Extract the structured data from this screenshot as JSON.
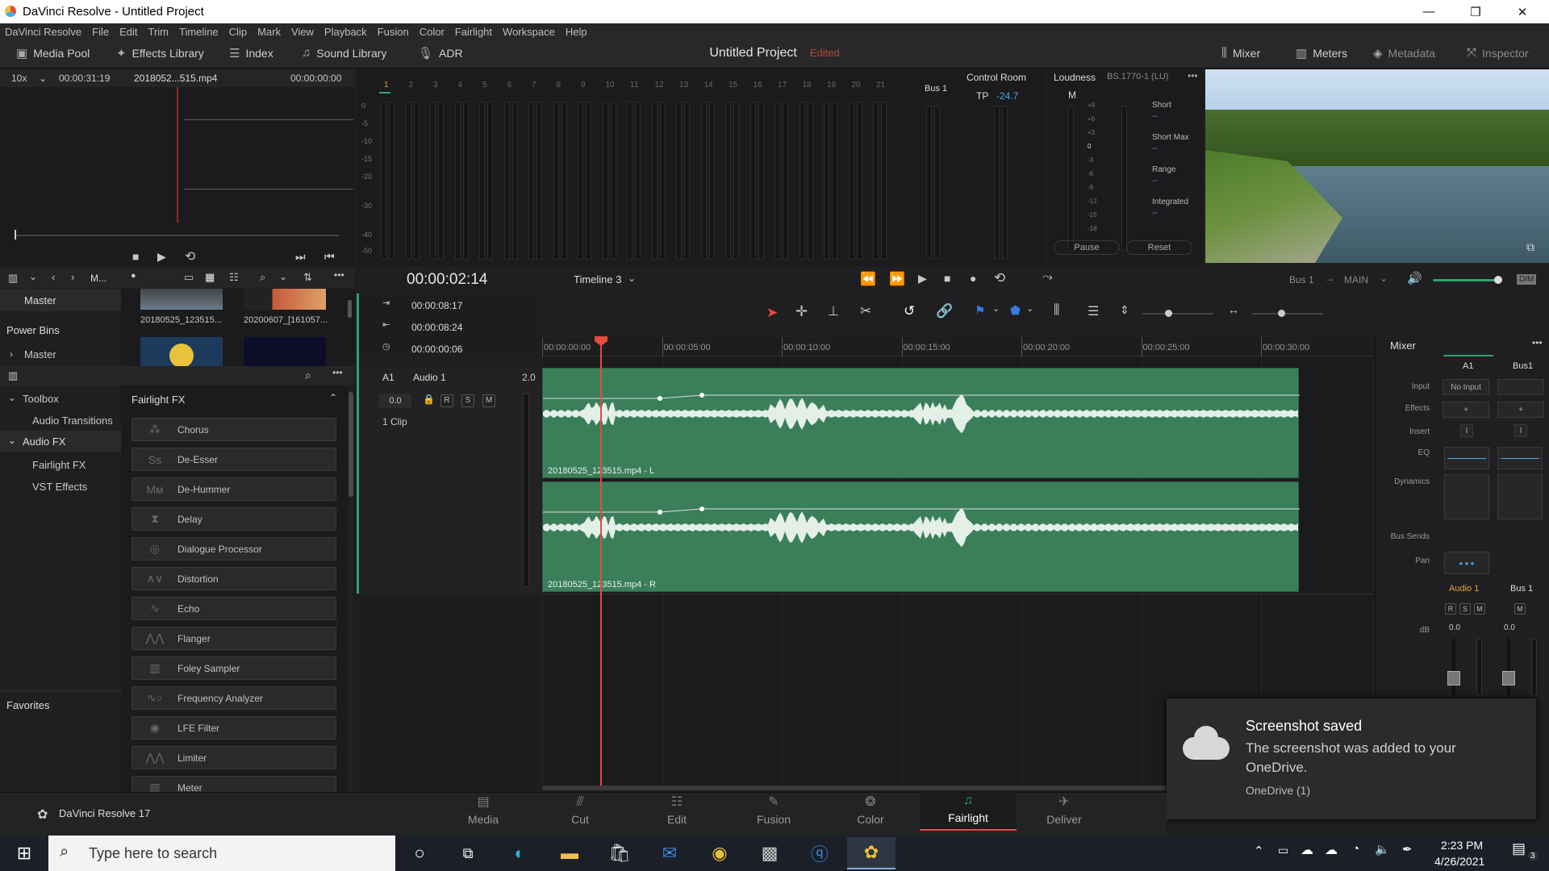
{
  "window": {
    "title": "DaVinci Resolve - Untitled Project",
    "min": "—",
    "max": "❐",
    "close": "✕"
  },
  "menu": [
    "DaVinci Resolve",
    "File",
    "Edit",
    "Trim",
    "Timeline",
    "Clip",
    "Mark",
    "View",
    "Playback",
    "Fusion",
    "Color",
    "Fairlight",
    "Workspace",
    "Help"
  ],
  "toolbar": {
    "media_pool": "Media Pool",
    "effects_library": "Effects Library",
    "index": "Index",
    "sound_library": "Sound Library",
    "adr": "ADR",
    "project": "Untitled Project",
    "edited": "Edited",
    "mixer": "Mixer",
    "meters": "Meters",
    "metadata": "Metadata",
    "inspector": "Inspector"
  },
  "viewer": {
    "zoom": "10x",
    "duration": "00:00:31:19",
    "clip": "2018052...515.mp4",
    "timecode": "00:00:00:00"
  },
  "meters": {
    "channels": [
      "1",
      "2",
      "3",
      "4",
      "5",
      "6",
      "7",
      "8",
      "9",
      "10",
      "11",
      "12",
      "13",
      "14",
      "15",
      "16",
      "17",
      "18",
      "19",
      "20",
      "21"
    ],
    "scale": [
      "0",
      "-5",
      "-10",
      "-15",
      "-20",
      "-30",
      "-40",
      "-50"
    ],
    "bus": "Bus 1",
    "control_room": "Control Room",
    "tp": "TP",
    "tp_value": "-24.7",
    "loudness": "Loudness",
    "loudness_std": "BS.1770-1 (LU)",
    "m": "M",
    "short": "Short",
    "short_max": "Short Max",
    "range": "Range",
    "integrated": "Integrated",
    "dashes": "--",
    "pause": "Pause",
    "reset": "Reset",
    "lu_scale": [
      "+9",
      "+6",
      "+3",
      "0",
      "-3",
      "-6",
      "-9",
      "-12",
      "-15",
      "-18"
    ]
  },
  "media": {
    "bin_label": "M...",
    "master": "Master",
    "power_bins": "Power Bins",
    "power_master": "Master",
    "thumb1": "20180525_123515...",
    "thumb2": "20200607_[161057..."
  },
  "effects": {
    "toolbox": "Toolbox",
    "audio_transitions": "Audio Transitions",
    "audio_fx": "Audio FX",
    "fairlight_fx": "Fairlight FX",
    "vst_effects": "VST Effects",
    "favorites": "Favorites",
    "header": "Fairlight FX",
    "items": [
      {
        "label": "Chorus",
        "icon": "chorus-icon"
      },
      {
        "label": "De-Esser",
        "icon": "de-esser-icon"
      },
      {
        "label": "De-Hummer",
        "icon": "de-hummer-icon"
      },
      {
        "label": "Delay",
        "icon": "delay-icon"
      },
      {
        "label": "Dialogue Processor",
        "icon": "dialogue-icon"
      },
      {
        "label": "Distortion",
        "icon": "distortion-icon"
      },
      {
        "label": "Echo",
        "icon": "echo-icon"
      },
      {
        "label": "Flanger",
        "icon": "flanger-icon"
      },
      {
        "label": "Foley Sampler",
        "icon": "foley-icon"
      },
      {
        "label": "Frequency Analyzer",
        "icon": "analyzer-icon"
      },
      {
        "label": "LFE Filter",
        "icon": "lfe-icon"
      },
      {
        "label": "Limiter",
        "icon": "limiter-icon"
      },
      {
        "label": "Meter",
        "icon": "meter-icon"
      }
    ]
  },
  "timeline": {
    "timecode": "00:00:02:14",
    "name": "Timeline 3",
    "in": "00:00:08:17",
    "out": "00:00:08:24",
    "dur": "00:00:00:06",
    "bus": "Bus 1",
    "main": "MAIN",
    "dim": "DIM",
    "ruler": [
      "00:00:00:00",
      "00:00:05:00",
      "00:00:10:00",
      "00:00:15:00",
      "00:00:20:00",
      "00:00:25:00",
      "00:00:30:00"
    ],
    "track": {
      "id": "A1",
      "name": "Audio 1",
      "format": "2.0",
      "volume": "0.0",
      "r": "R",
      "s": "S",
      "m": "M",
      "clips": "1 Clip"
    },
    "clip_l": "20180525_123515.mp4 - L",
    "clip_r": "20180525_123515.mp4 - R"
  },
  "mixer": {
    "title": "Mixer",
    "a1": "A1",
    "bus1": "Bus1",
    "input": "Input",
    "no_input": "No Input",
    "effects": "Effects",
    "insert": "Insert",
    "eq": "EQ",
    "dynamics": "Dynamics",
    "bus_sends": "Bus Sends",
    "pan": "Pan",
    "audio1": "Audio 1",
    "bus1b": "Bus 1",
    "db": "dB",
    "db_a": "0.0",
    "db_b": "0.0",
    "r": "R",
    "s": "S",
    "m": "M"
  },
  "toast": {
    "title": "Screenshot saved",
    "body": "The screenshot was added to your OneDrive.",
    "source": "OneDrive (1)"
  },
  "pages": [
    "Media",
    "Cut",
    "Edit",
    "Fusion",
    "Color",
    "Fairlight",
    "Deliver"
  ],
  "app_version": "DaVinci Resolve 17",
  "taskbar": {
    "search": "Type here to search",
    "time": "2:23 PM",
    "date": "4/26/2021",
    "notif_count": "3"
  },
  "colors": {
    "accent": "#e64b3c",
    "clip_green": "#3a7f5a",
    "fairlight_active": "#e64b3c"
  }
}
